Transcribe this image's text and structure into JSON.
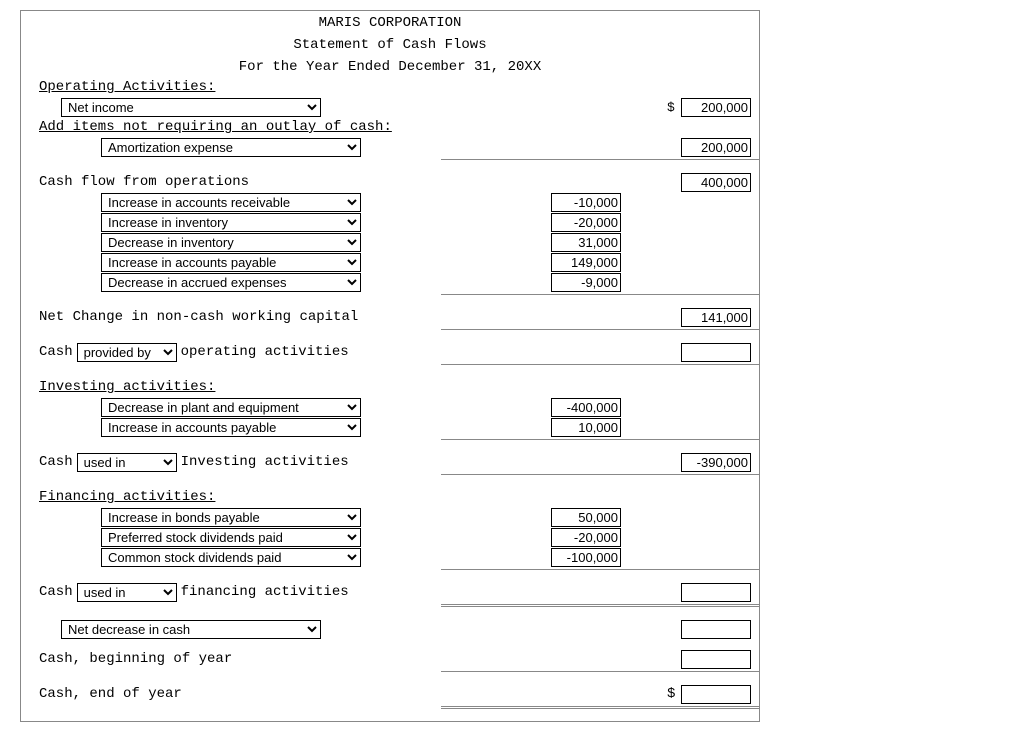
{
  "title1": "MARIS CORPORATION",
  "title2": "Statement of Cash Flows",
  "title3": "For the Year Ended December 31, 20XX",
  "op_header": "Operating Activities:",
  "net_income_sel": "Net income",
  "net_income_val": "200,000",
  "add_items": "Add items not requiring an outlay of cash:",
  "amort_sel": "Amortization expense",
  "amort_val": "200,000",
  "cfo_label": "Cash flow from operations",
  "cfo_val": "400,000",
  "op_adj": [
    {
      "sel": "Increase in accounts receivable",
      "val": "-10,000"
    },
    {
      "sel": "Increase in inventory",
      "val": "-20,000"
    },
    {
      "sel": "Decrease in inventory",
      "val": "31,000"
    },
    {
      "sel": "Increase in accounts payable",
      "val": "149,000"
    },
    {
      "sel": "Decrease in accrued expenses",
      "val": "-9,000"
    }
  ],
  "netchg_label": "Net Change in non-cash working capital",
  "netchg_val": "141,000",
  "cash_word": "Cash",
  "op_provused": "provided by",
  "op_tail": " operating activities",
  "inv_header": "Investing activities:",
  "inv_adj": [
    {
      "sel": "Decrease in plant and equipment",
      "val": "-400,000"
    },
    {
      "sel": "Increase in accounts payable",
      "val": "10,000"
    }
  ],
  "inv_provused": "used in",
  "inv_tail": " Investing activities",
  "inv_total": "-390,000",
  "fin_header": "Financing activities:",
  "fin_adj": [
    {
      "sel": "Increase in bonds payable",
      "val": "50,000"
    },
    {
      "sel": "Preferred stock dividends paid",
      "val": "-20,000"
    },
    {
      "sel": "Common stock dividends paid",
      "val": "-100,000"
    }
  ],
  "fin_provused": "used in",
  "fin_tail": " financing activities",
  "netdec_sel": "Net decrease in cash",
  "cash_beg": "Cash, beginning of year",
  "cash_end": "Cash, end of year",
  "dollar": "$"
}
